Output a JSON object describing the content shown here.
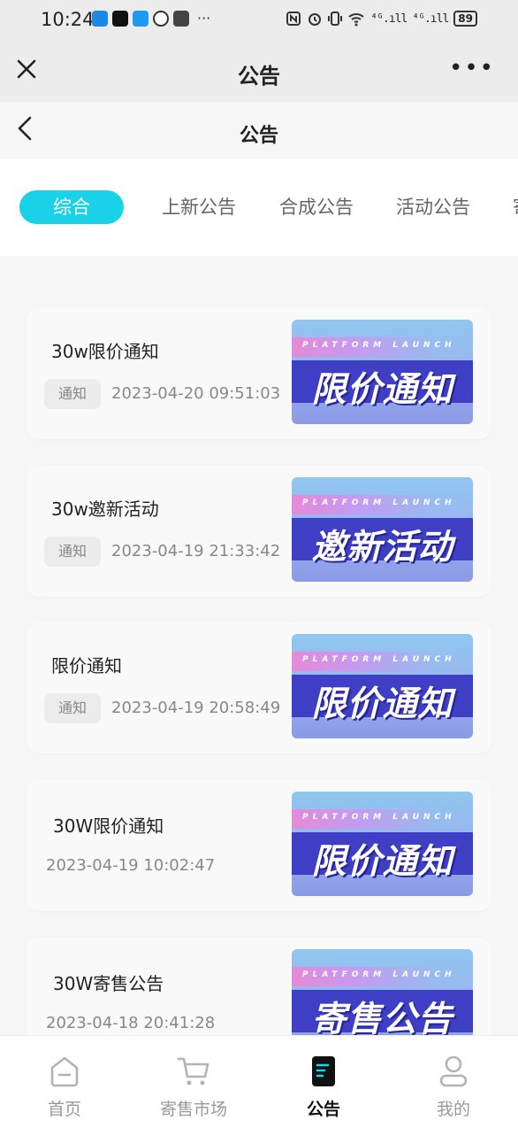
{
  "status_bar": {
    "time": "10:24",
    "overflow": "···",
    "network_4g_a": "⁴ᴳ.ıll",
    "network_4g_b": "⁴ᴳ.ıll",
    "battery": "89"
  },
  "top_bar": {
    "title": "公告",
    "close_icon": "close-icon",
    "more_icon": "more-icon",
    "more_label": "•••"
  },
  "page_header": {
    "title": "公告",
    "back_icon": "chevron-left-icon"
  },
  "tabs": [
    {
      "label": "综合",
      "active": true
    },
    {
      "label": "上新公告",
      "active": false
    },
    {
      "label": "合成公告",
      "active": false
    },
    {
      "label": "活动公告",
      "active": false
    },
    {
      "label": "寄",
      "active": false
    }
  ],
  "announcements": [
    {
      "title": "30w限价通知",
      "tag": "通知",
      "date": "2023-04-20 09:51:03",
      "thumb_sub": "PLATFORM LAUNCH",
      "thumb_title": "限价通知"
    },
    {
      "title": "30w邀新活动",
      "tag": "通知",
      "date": "2023-04-19 21:33:42",
      "thumb_sub": "PLATFORM LAUNCH",
      "thumb_title": "邀新活动"
    },
    {
      "title": "限价通知",
      "tag": "通知",
      "date": "2023-04-19 20:58:49",
      "thumb_sub": "PLATFORM LAUNCH",
      "thumb_title": "限价通知"
    },
    {
      "title": "30W限价通知",
      "tag": "",
      "date": "2023-04-19 10:02:47",
      "thumb_sub": "PLATFORM LAUNCH",
      "thumb_title": "限价通知"
    },
    {
      "title": "30W寄售公告",
      "tag": "",
      "date": "2023-04-18 20:41:28",
      "thumb_sub": "PLATFORM LAUNCH",
      "thumb_title": "寄售公告"
    }
  ],
  "bottom_nav": [
    {
      "label": "首页",
      "icon": "home-icon",
      "active": false
    },
    {
      "label": "寄售市场",
      "icon": "cart-icon",
      "active": false
    },
    {
      "label": "公告",
      "icon": "notice-icon",
      "active": true
    },
    {
      "label": "我的",
      "icon": "user-icon",
      "active": false
    }
  ],
  "colors": {
    "accent": "#1ad2e7",
    "thumb_band": "#3f3fc6",
    "active_icon": "#111111"
  }
}
